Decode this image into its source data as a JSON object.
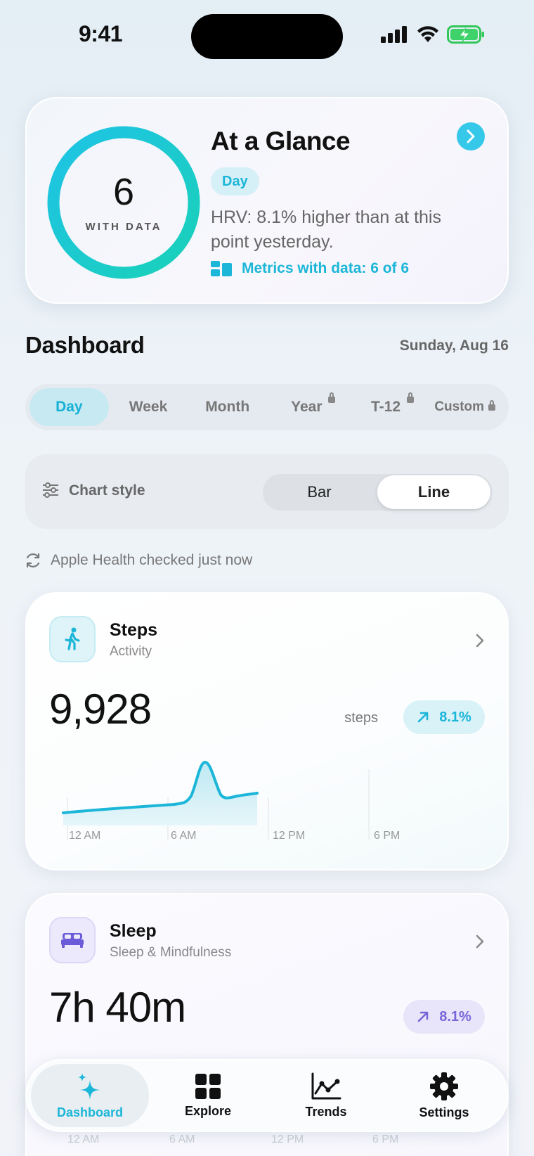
{
  "status": {
    "time": "9:41"
  },
  "glance": {
    "count": "6",
    "count_label": "WITH DATA",
    "title": "At a Glance",
    "chip": "Day",
    "description": "HRV: 8.1% higher than at this point yesterday.",
    "metrics": "Metrics with data: 6 of 6",
    "ring_fraction": 1.0
  },
  "dashboard": {
    "title": "Dashboard",
    "date": "Sunday, Aug 16"
  },
  "segments": [
    {
      "label": "Day",
      "active": true,
      "locked": false
    },
    {
      "label": "Week",
      "active": false,
      "locked": false
    },
    {
      "label": "Month",
      "active": false,
      "locked": false
    },
    {
      "label": "Year",
      "active": false,
      "locked": true
    },
    {
      "label": "T-12",
      "active": false,
      "locked": true
    },
    {
      "label": "Custom",
      "active": false,
      "locked": true
    }
  ],
  "chart_style": {
    "label": "Chart style",
    "options": [
      "Bar",
      "Line"
    ],
    "selected": "Line"
  },
  "health_check": "Apple Health checked just now",
  "steps": {
    "title": "Steps",
    "subtitle": "Activity",
    "value": "9,928",
    "unit": "steps",
    "change": "8.1%",
    "ticks": [
      "12 AM",
      "6 AM",
      "12 PM",
      "6 PM"
    ]
  },
  "sleep": {
    "title": "Sleep",
    "subtitle": "Sleep & Mindfulness",
    "value": "7h 40m",
    "change": "8.1%",
    "ticks": [
      "12 AM",
      "6 AM",
      "12 PM",
      "6 PM"
    ]
  },
  "tabs": [
    {
      "label": "Dashboard",
      "icon": "sparkles-icon",
      "active": true
    },
    {
      "label": "Explore",
      "icon": "grid-icon",
      "active": false
    },
    {
      "label": "Trends",
      "icon": "trends-icon",
      "active": false
    },
    {
      "label": "Settings",
      "icon": "gear-icon",
      "active": false
    }
  ],
  "colors": {
    "accent": "#1cb6d8",
    "sleep_accent": "#7a66d8",
    "ring_start": "#1fc3e6",
    "ring_end": "#19d1b8"
  }
}
